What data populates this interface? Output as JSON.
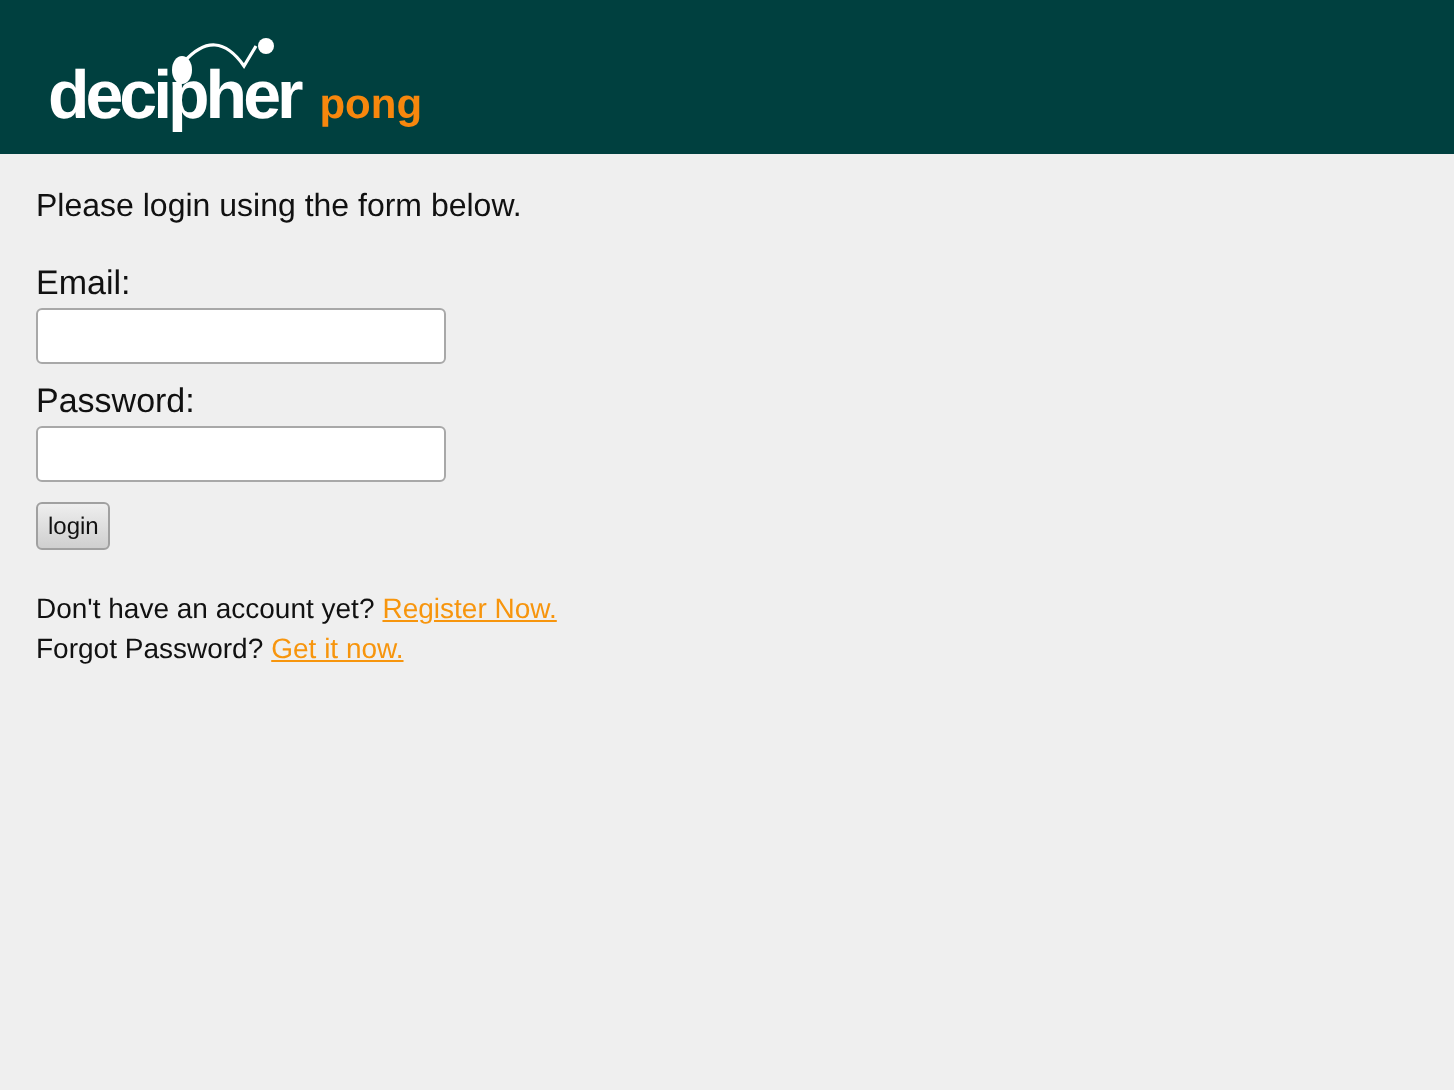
{
  "header": {
    "logo": "decipher",
    "product": "pong"
  },
  "intro": "Please login using the form below.",
  "fields": [
    {
      "label": "Email:"
    },
    {
      "label": "Password:"
    }
  ],
  "button": "login",
  "links": [
    {
      "prompt": "Don't have an account yet?",
      "link": "Register Now."
    },
    {
      "prompt": "Forgot Password?",
      "link": "Get it now."
    }
  ]
}
